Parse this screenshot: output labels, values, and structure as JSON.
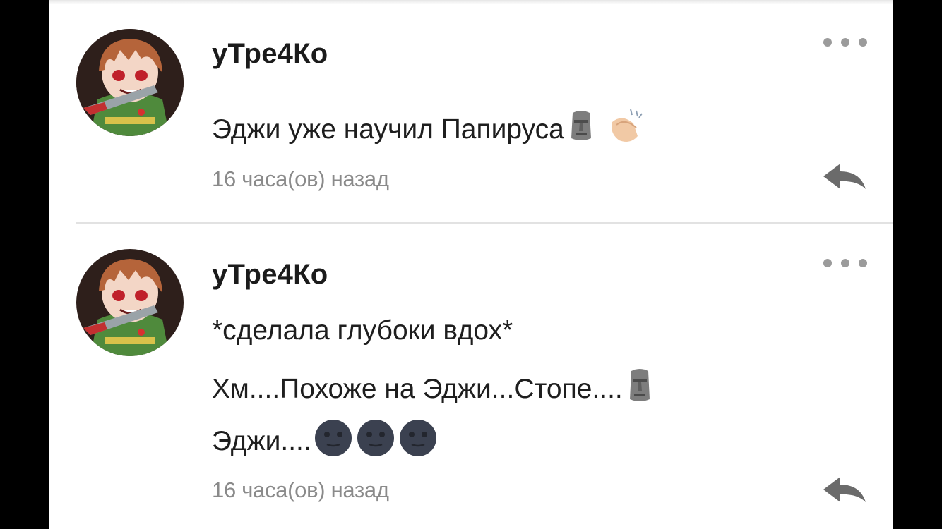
{
  "comments": [
    {
      "username": "уТре4Ко",
      "lines": [
        {
          "text": "Эджи уже научил Папируса",
          "emojis": [
            "moai-emoji",
            "clapping-hands-emoji"
          ]
        }
      ],
      "timestamp": "16 часа(ов) назад",
      "avatar_icon": "chara-avatar"
    },
    {
      "username": "уТре4Ко",
      "lines": [
        {
          "text": "*сделала глубоки вдох*",
          "emojis": []
        },
        {
          "text": "Хм....Похоже на Эджи...Стопе....",
          "emojis": [
            "moai-emoji"
          ]
        },
        {
          "text": "Эджи....",
          "emojis": [
            "new-moon-face-emoji",
            "new-moon-face-emoji",
            "new-moon-face-emoji"
          ]
        }
      ],
      "timestamp": "16 часа(ов) назад",
      "avatar_icon": "chara-avatar"
    }
  ],
  "icons": {
    "more": "more-dots-icon",
    "reply": "reply-arrow-icon"
  },
  "colors": {
    "background": "#ffffff",
    "username": "#1b1b1b",
    "text": "#1e1e1e",
    "timestamp": "#8a8a8a",
    "icon_gray": "#6b6b6b",
    "divider": "#e2e2e2"
  }
}
